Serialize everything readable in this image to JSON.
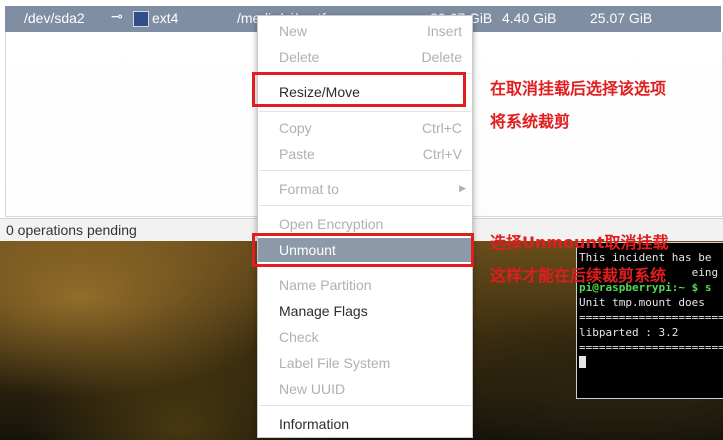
{
  "partition_row": {
    "device": "/dev/sda2",
    "key_icon": "key-icon",
    "fs_color": "#2f4f86",
    "filesystem": "ext4",
    "mountpoint": "/media/pi/rootfs",
    "used": "20.67 GiB",
    "unused": "4.40 GiB",
    "size": "25.07 GiB"
  },
  "status_bar": {
    "text": "0 operations pending"
  },
  "context_menu": {
    "new": {
      "label": "New",
      "accel": "Insert"
    },
    "delete": {
      "label": "Delete",
      "accel": "Delete"
    },
    "resize_move": {
      "label": "Resize/Move"
    },
    "copy": {
      "label": "Copy",
      "accel": "Ctrl+C"
    },
    "paste": {
      "label": "Paste",
      "accel": "Ctrl+V"
    },
    "format_to": {
      "label": "Format to"
    },
    "open_encryption": {
      "label": "Open Encryption"
    },
    "unmount": {
      "label": "Unmount"
    },
    "name_partition": {
      "label": "Name Partition"
    },
    "manage_flags": {
      "label": "Manage Flags"
    },
    "check": {
      "label": "Check"
    },
    "label_file_system": {
      "label": "Label File System"
    },
    "new_uuid": {
      "label": "New UUID"
    },
    "information": {
      "label": "Information"
    }
  },
  "annotations": {
    "resize_note_line1": "在取消挂载后选择该选项",
    "resize_note_line2": "将系统裁剪",
    "unmount_note_line1": "选择Unmount取消挂载",
    "unmount_note_line2": "这样才能在后续裁剪系统",
    "highlight_color": "#e11d1d"
  },
  "terminal": {
    "line1": "This incident has be",
    "line2": "                 eing",
    "prompt": "pi@raspberrypi:~ $ s",
    "line4": "Unit tmp.mount does",
    "line5": "=======================",
    "line6": "libparted : 3.2",
    "line7": "======================="
  }
}
